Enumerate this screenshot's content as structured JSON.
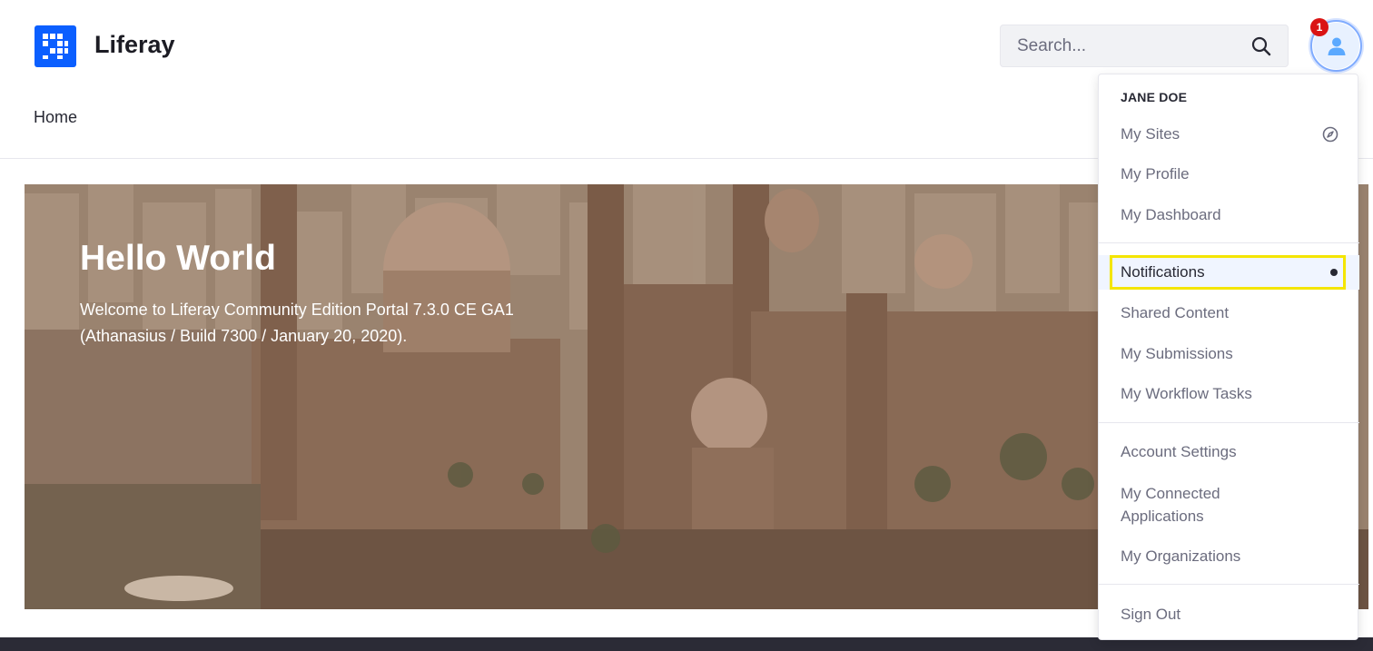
{
  "header": {
    "site_name": "Liferay",
    "search_placeholder": "Search...",
    "notification_count": "1"
  },
  "nav": {
    "home_label": "Home"
  },
  "banner": {
    "title": "Hello World",
    "text": "Welcome to Liferay Community Edition Portal 7.3.0 CE GA1 (Athanasius / Build 7300 / January 20, 2020)."
  },
  "user_menu": {
    "user_name": "JANE DOE",
    "items": {
      "my_sites": "My Sites",
      "my_profile": "My Profile",
      "my_dashboard": "My Dashboard",
      "notifications": "Notifications",
      "shared_content": "Shared Content",
      "my_submissions": "My Submissions",
      "my_workflow_tasks": "My Workflow Tasks",
      "account_settings": "Account Settings",
      "my_connected_applications_1": "My Connected",
      "my_connected_applications_2": "Applications",
      "my_organizations": "My Organizations",
      "sign_out": "Sign Out"
    }
  },
  "colors": {
    "brand": "#0b5fff",
    "badge": "#da1414",
    "highlight": "#f4e500"
  },
  "icons": [
    "liferay-logo-icon",
    "search-icon",
    "user-icon",
    "compass-icon",
    "unread-dot-icon"
  ]
}
